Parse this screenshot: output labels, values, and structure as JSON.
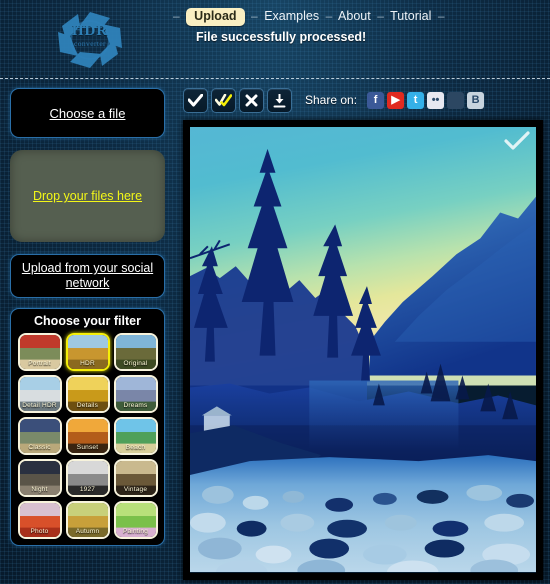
{
  "brand": {
    "logo_title": "HDR",
    "logo_subtitle": "converter",
    "logo_icon": "aperture-icon",
    "accent_color": "#2e7fb5"
  },
  "nav": {
    "active_label": "Upload",
    "items": [
      {
        "label": "Examples"
      },
      {
        "label": "About"
      },
      {
        "label": "Tutorial"
      }
    ],
    "separator": "–"
  },
  "status": {
    "message": "File successfully processed!"
  },
  "sidebar": {
    "choose_file_label": "Choose a file",
    "dropzone_label": "Drop your files here",
    "upload_social_label": "Upload from your social network",
    "filters_title": "Choose your filter",
    "filters": [
      {
        "label": "Portrait",
        "selected": false,
        "c1": "#c0392b",
        "c2": "#7c8c5a",
        "c3": "#d9c9a0"
      },
      {
        "label": "HDR",
        "selected": true,
        "c1": "#9fc8e0",
        "c2": "#c8962f",
        "c3": "#8b6a1f"
      },
      {
        "label": "Original",
        "selected": false,
        "c1": "#7fb5d8",
        "c2": "#6a6a3a",
        "c3": "#3d4a22"
      },
      {
        "label": "Detail HDR",
        "selected": false,
        "c1": "#a8cfe6",
        "c2": "#d8dde0",
        "c3": "#6d7a80"
      },
      {
        "label": "Details",
        "selected": false,
        "c1": "#efd25a",
        "c2": "#c99a1a",
        "c3": "#6d4f10"
      },
      {
        "label": "Dreams",
        "selected": false,
        "c1": "#9fb6d8",
        "c2": "#7a86a8",
        "c3": "#3f5c3a"
      },
      {
        "label": "Classic",
        "selected": false,
        "c1": "#3b4f7a",
        "c2": "#7a8a6a",
        "c3": "#b9a87a"
      },
      {
        "label": "Sunset",
        "selected": false,
        "c1": "#f0a83a",
        "c2": "#b35c1a",
        "c3": "#3a2410"
      },
      {
        "label": "Beach",
        "selected": false,
        "c1": "#6fc4e8",
        "c2": "#4fa05a",
        "c3": "#d8cf9a"
      },
      {
        "label": "Night",
        "selected": false,
        "c1": "#2a3040",
        "c2": "#5a5448",
        "c3": "#8a8070"
      },
      {
        "label": "1927",
        "selected": false,
        "c1": "#d8d8d8",
        "c2": "#8a8a8a",
        "c3": "#2a2a2a"
      },
      {
        "label": "Vintage",
        "selected": false,
        "c1": "#c9b98e",
        "c2": "#6a5838",
        "c3": "#2d2418"
      },
      {
        "label": "Photo",
        "selected": false,
        "c1": "#d8c0d0",
        "c2": "#d8502a",
        "c3": "#a8301a"
      },
      {
        "label": "Autumn",
        "selected": false,
        "c1": "#c8d07a",
        "c2": "#c8a03a",
        "c3": "#7a6a2a"
      },
      {
        "label": "Painting",
        "selected": false,
        "c1": "#b8e07a",
        "c2": "#7ac04a",
        "c3": "#d8b0d0"
      }
    ]
  },
  "toolbar": {
    "buttons": [
      {
        "name": "apply-check-button",
        "icon": "check-icon",
        "color": "#ffffff"
      },
      {
        "name": "apply-all-check-button",
        "icon": "double-check-icon",
        "color": "#f5ef08"
      },
      {
        "name": "close-button",
        "icon": "close-x-icon",
        "color": "#ffffff"
      },
      {
        "name": "download-button",
        "icon": "download-icon",
        "color": "#ffffff"
      }
    ],
    "share_label": "Share on:",
    "social": [
      {
        "name": "facebook",
        "glyph": "f",
        "bg": "#3b5998"
      },
      {
        "name": "youtube",
        "glyph": "▶",
        "bg": "#e02a20"
      },
      {
        "name": "twitter",
        "glyph": "t",
        "bg": "#35b0e8"
      },
      {
        "name": "flickr",
        "glyph": "••",
        "bg": "#e8e8f0"
      },
      {
        "name": "tumblr",
        "glyph": "",
        "bg": "#2c4762"
      },
      {
        "name": "blogger",
        "glyph": "B",
        "bg": "#c8d4de"
      }
    ]
  },
  "preview": {
    "overlay_icon": "check-icon",
    "alt": "HDR processed landscape photograph: blue-toned pine forest, mountain ridge and rocky riverbed at dusk"
  }
}
